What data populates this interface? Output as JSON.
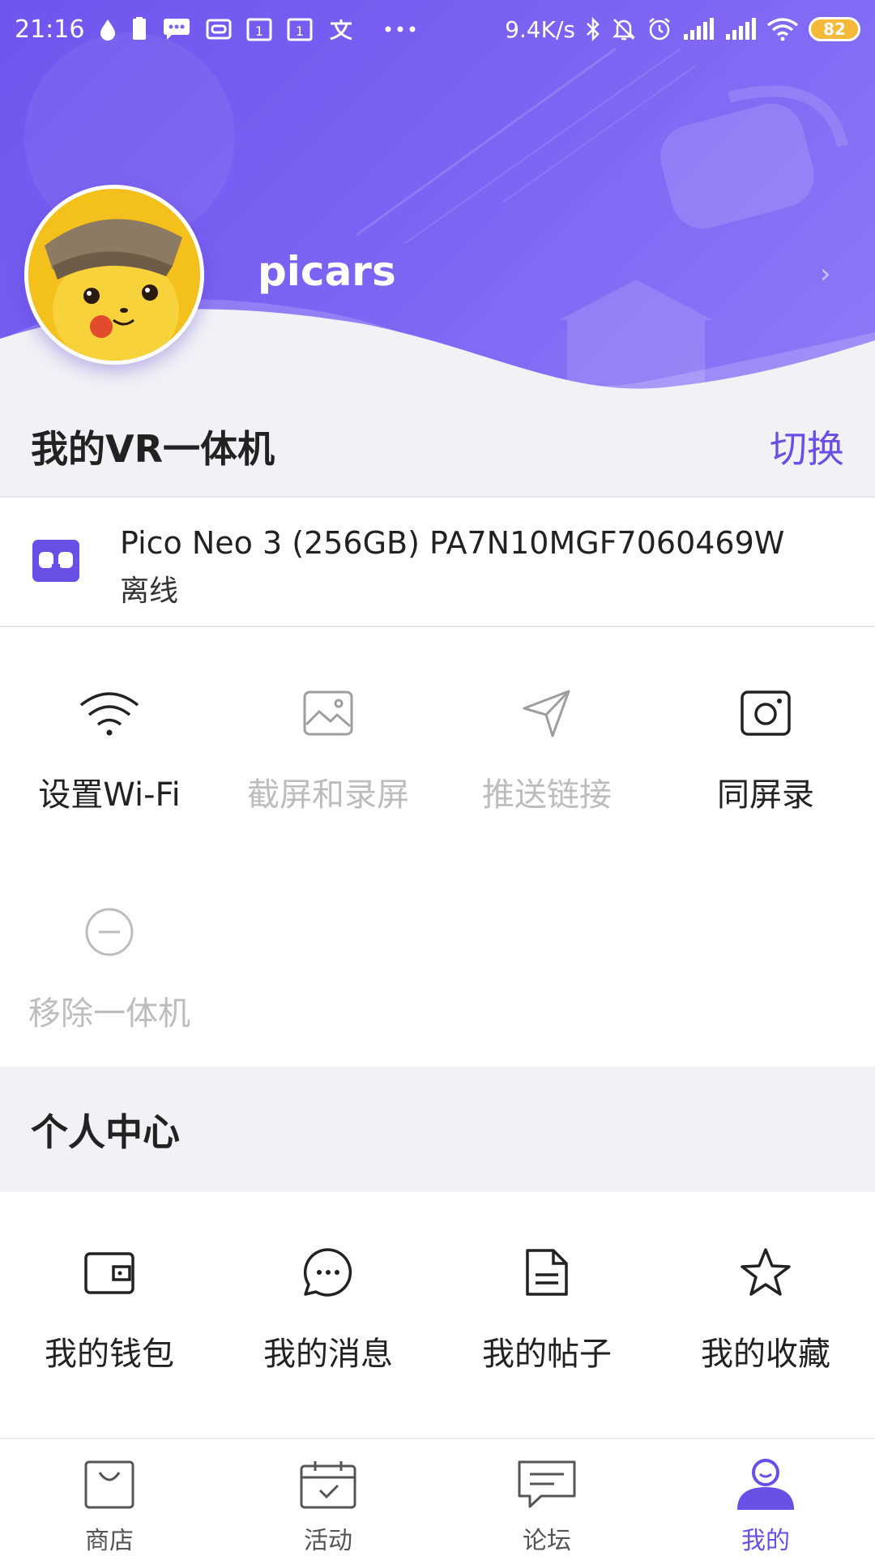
{
  "status_bar": {
    "time": "21:16",
    "network_speed": "9.4K/s",
    "battery_level": "82",
    "left_icons": [
      "water-drop-icon",
      "sim-icon",
      "message-icon",
      "vr-app-icon",
      "calendar-1-icon",
      "calendar-1-icon",
      "translate-icon",
      "more-dots-icon"
    ],
    "right_icons": [
      "bluetooth-icon",
      "mute-bell-icon",
      "alarm-icon",
      "signal-icon",
      "signal-icon",
      "wifi-icon"
    ]
  },
  "profile": {
    "username": "picars"
  },
  "vr_section": {
    "title": "我的VR一体机",
    "switch_label": "切换"
  },
  "device": {
    "name": "Pico Neo 3 (256GB) PA7N10MGF7060469W",
    "status": "离线"
  },
  "device_actions": [
    {
      "label": "设置Wi-Fi",
      "icon": "wifi-icon",
      "enabled": true
    },
    {
      "label": "截屏和录屏",
      "icon": "image-icon",
      "enabled": false
    },
    {
      "label": "推送链接",
      "icon": "send-icon",
      "enabled": false
    },
    {
      "label": "同屏录",
      "icon": "camera-icon",
      "enabled": true
    },
    {
      "label": "移除一体机",
      "icon": "remove-circle-icon",
      "enabled": false
    }
  ],
  "personal_section": {
    "title": "个人中心"
  },
  "personal_actions": [
    {
      "label": "我的钱包",
      "icon": "wallet-icon"
    },
    {
      "label": "我的消息",
      "icon": "chat-bubble-icon"
    },
    {
      "label": "我的帖子",
      "icon": "document-icon"
    },
    {
      "label": "我的收藏",
      "icon": "star-icon"
    }
  ],
  "bottom_nav": [
    {
      "label": "商店",
      "icon": "shopping-bag-icon",
      "active": false
    },
    {
      "label": "活动",
      "icon": "calendar-check-icon",
      "active": false
    },
    {
      "label": "论坛",
      "icon": "forum-icon",
      "active": false
    },
    {
      "label": "我的",
      "icon": "user-icon",
      "active": true
    }
  ],
  "colors": {
    "brand": "#6a4fe6",
    "header_gradient_start": "#6f55ee",
    "header_gradient_end": "#8d79f7",
    "section_bg": "#f2f1f6",
    "disabled_text": "#bdbdbd"
  }
}
